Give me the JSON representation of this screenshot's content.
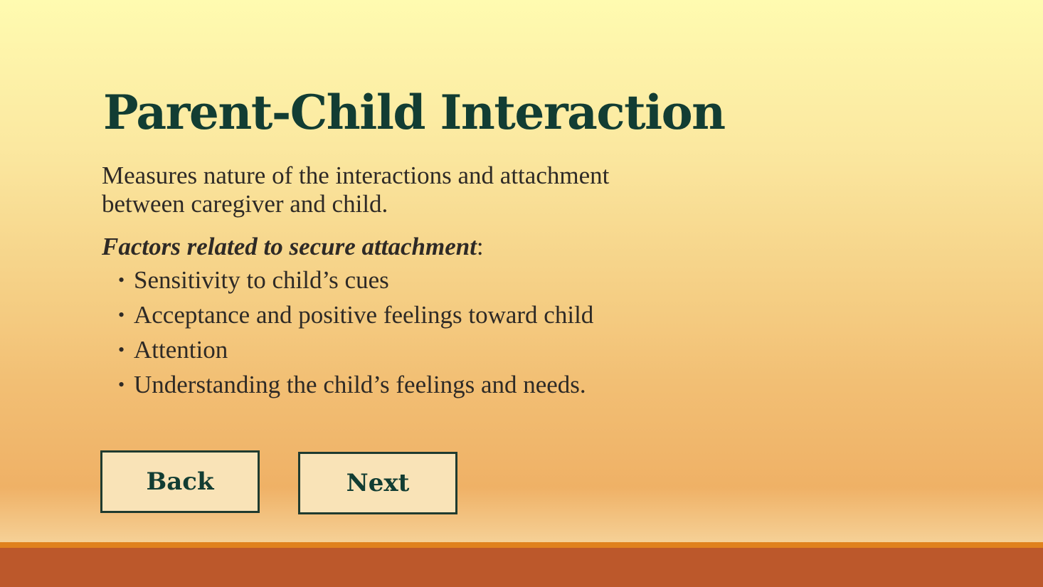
{
  "slide": {
    "title": "Parent-Child Interaction",
    "intro": "Measures nature of the interactions and attachment  between caregiver and child.",
    "factors_lead": "Factors related to secure attachment",
    "factors_colon": ":",
    "bullet_symbol": "•",
    "bullets": [
      "Sensitivity to child’s cues",
      "Acceptance and positive feelings toward child",
      "Attention",
      "Understanding the child’s feelings and needs."
    ]
  },
  "nav": {
    "back_label": "Back",
    "next_label": "Next"
  },
  "colors": {
    "title": "#123d33",
    "button_fill": "#f9e3b7",
    "footer_accent": "#e0811d",
    "footer_bar": "#bc582b"
  }
}
